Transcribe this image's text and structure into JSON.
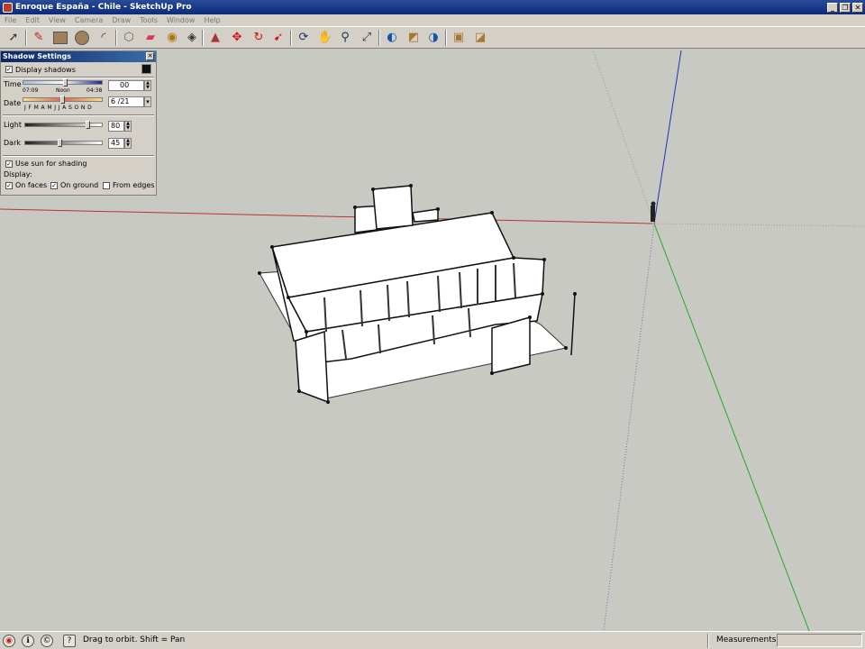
{
  "window": {
    "title": "Enroque España - Chile - SketchUp Pro"
  },
  "menu": [
    "File",
    "Edit",
    "View",
    "Camera",
    "Draw",
    "Tools",
    "Window",
    "Help"
  ],
  "toolbar_icons": [
    "select-icon",
    "pencil-icon",
    "rectangle-icon",
    "circle-icon",
    "arc-icon",
    "eraser-icon",
    "paint-bucket-icon",
    "tape-measure-icon",
    "push-pull-icon",
    "move-icon",
    "rotate-icon",
    "follow-me-icon",
    "orbit-icon",
    "pan-icon",
    "zoom-icon",
    "zoom-extents-icon",
    "previous-view-icon",
    "next-view-icon",
    "get-models-icon",
    "share-model-icon",
    "component-icon",
    "dynamic-component-icon"
  ],
  "shadow_panel": {
    "title": "Shadow Settings",
    "display_shadows_label": "Display shadows",
    "time_label": "Time",
    "time_start": "07:09",
    "time_noon": "Noon",
    "time_end": "04:38",
    "time_value": "00",
    "date_label": "Date",
    "date_months": "J F M A M J J A S O N D",
    "date_value": "6 /21",
    "light_label": "Light",
    "light_value": "80",
    "dark_label": "Dark",
    "dark_value": "45",
    "use_sun_label": "Use sun for shading",
    "display_label": "Display:",
    "on_faces_label": "On faces",
    "on_ground_label": "On ground",
    "from_edges_label": "From edges",
    "display_shadows": true,
    "use_sun": true,
    "on_faces": true,
    "on_ground": true,
    "from_edges": false
  },
  "status": {
    "hint": "Drag to orbit.  Shift = Pan",
    "measurements_label": "Measurements"
  }
}
